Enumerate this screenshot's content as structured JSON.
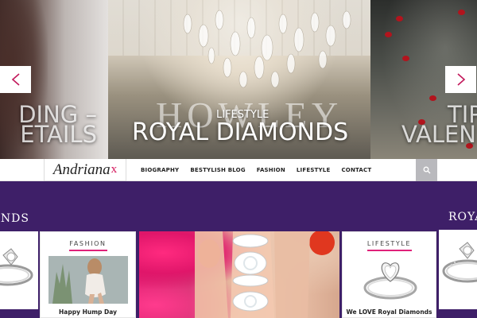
{
  "slider": {
    "prev_arrow": "<",
    "next_arrow": ">",
    "left_slide": {
      "title_line1": "DING –",
      "title_line2": "ETAILS"
    },
    "center_slide": {
      "category": "LIFESTYLE",
      "title": "ROYAL DIAMONDS",
      "wall_text": "HOWLEY"
    },
    "right_slide": {
      "title_line1": "TIP",
      "title_line2": "VALEN"
    }
  },
  "header": {
    "logo_text": "Andriana",
    "logo_mark": "x",
    "nav": [
      "BIOGRAPHY",
      "BESTYLISH BLOG",
      "FASHION",
      "LIFESTYLE",
      "CONTACT"
    ],
    "search_icon": "search-icon"
  },
  "featured": {
    "left_heading": "ONDS",
    "right_heading": "ROYAL",
    "cards": [
      {
        "category": "FASHION",
        "title": "Happy Hump Day"
      },
      {
        "category": "LIFESTYLE",
        "title": "We LOVE Royal Diamonds"
      }
    ]
  },
  "colors": {
    "accent_pink": "#e0217a",
    "purple_band": "#3e1f68",
    "search_bg": "#b9b9bd"
  }
}
